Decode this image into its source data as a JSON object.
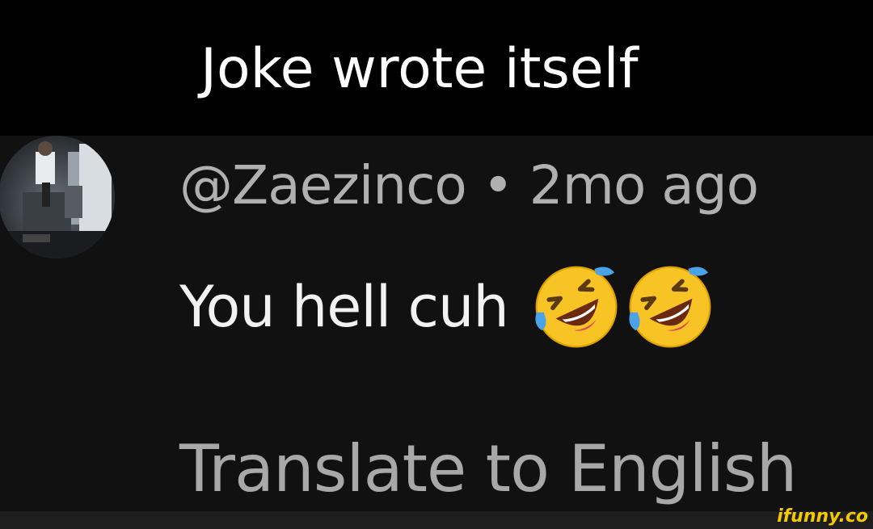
{
  "caption": {
    "text": "Joke wrote itself"
  },
  "comment": {
    "avatar_icon": "user-avatar-photo",
    "handle": "@Zaezinco",
    "separator": "•",
    "timestamp": "2mo ago",
    "text": "You hell cuh",
    "emojis": [
      "rolling-on-floor-laughing-emoji",
      "rolling-on-floor-laughing-emoji"
    ],
    "translate_label": "Translate to English"
  },
  "watermark": {
    "text": "ifunny.co",
    "color": "#f5c800"
  }
}
